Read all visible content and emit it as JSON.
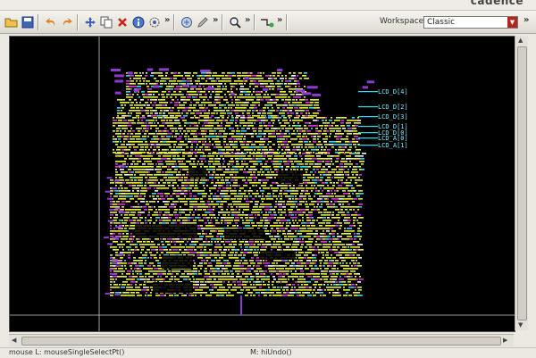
{
  "brand": {
    "logo_text": "cadence"
  },
  "toolbar": {
    "icons": [
      "open-folder-icon",
      "save-icon",
      "undo-icon",
      "redo-icon",
      "move-icon",
      "copy-icon",
      "delete-icon",
      "info-icon",
      "stretch-icon",
      "fit-icon",
      "edit-icon",
      "zoom-icon",
      "route-icon"
    ],
    "more_glyph": "»",
    "workspace_label": "Workspace:",
    "workspace_value": "Classic"
  },
  "layout": {
    "pins": [
      "LCD_D[4]",
      "LCD_D[2]",
      "LCD_D[3]",
      "LCD_D[1]",
      "LCD_D[0]",
      "LCD_A[0]",
      "LCD_A[1]"
    ],
    "colors": {
      "metal1": "#e6ef39",
      "metal2": "#d33ad9",
      "via": "#35d9ef",
      "route": "#8d3ad0",
      "background": "#000000"
    }
  },
  "status": {
    "left": "mouse L: mouseSingleSelectPt()",
    "middle": "M: hiUndo()"
  }
}
